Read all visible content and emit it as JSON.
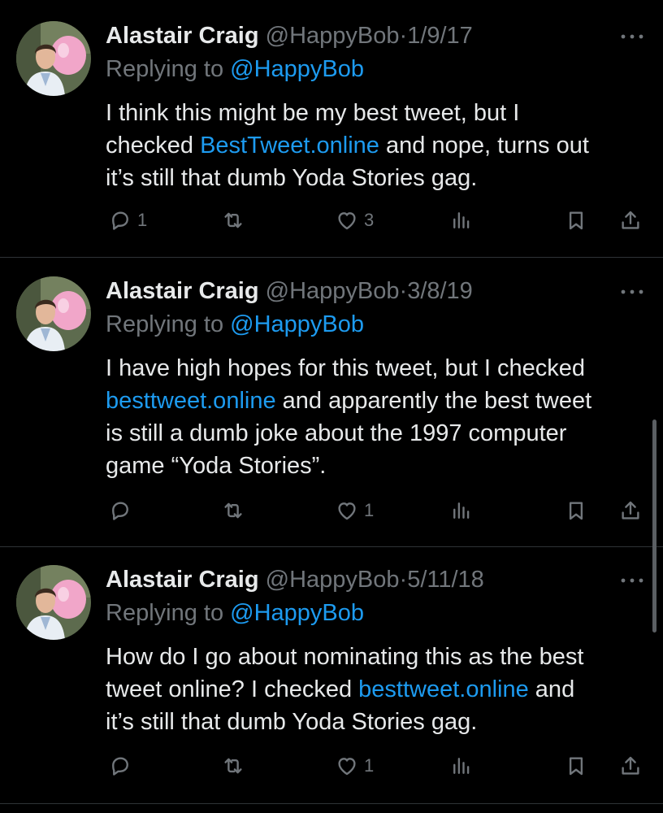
{
  "colors": {
    "background": "#000000",
    "text": "#e7e9ea",
    "muted": "#71767b",
    "link": "#1d9bf0",
    "divider": "#2f3336"
  },
  "tweets": [
    {
      "author_name": "Alastair Craig",
      "handle": "@HappyBob",
      "separator": "·",
      "date": "1/9/17",
      "reply_prefix": "Replying to",
      "reply_to": "@HappyBob",
      "lines": [
        {
          "before": "I think this might be my best tweet, but I",
          "link": "",
          "after": ""
        },
        {
          "before": "checked ",
          "link": "BestTweet.online",
          "after": " and nope, turns out"
        },
        {
          "before": "it’s still that dumb Yoda Stories gag.",
          "link": "",
          "after": ""
        }
      ],
      "counts": {
        "replies": "1",
        "retweets": "",
        "likes": "3"
      }
    },
    {
      "author_name": "Alastair Craig",
      "handle": "@HappyBob",
      "separator": "·",
      "date": "3/8/19",
      "reply_prefix": "Replying to",
      "reply_to": "@HappyBob",
      "lines": [
        {
          "before": "I have high hopes for this tweet, but I checked",
          "link": "",
          "after": ""
        },
        {
          "before": "",
          "link": "besttweet.online",
          "after": " and apparently the best tweet"
        },
        {
          "before": "is still a dumb joke about the 1997 computer",
          "link": "",
          "after": ""
        },
        {
          "before": "game “Yoda Stories”.",
          "link": "",
          "after": ""
        }
      ],
      "counts": {
        "replies": "",
        "retweets": "",
        "likes": "1"
      }
    },
    {
      "author_name": "Alastair Craig",
      "handle": "@HappyBob",
      "separator": "·",
      "date": "5/11/18",
      "reply_prefix": "Replying to",
      "reply_to": "@HappyBob",
      "lines": [
        {
          "before": "How do I go about nominating this as the best",
          "link": "",
          "after": ""
        },
        {
          "before": "tweet online? I checked ",
          "link": "besttweet.online",
          "after": " and"
        },
        {
          "before": "it’s still that dumb Yoda Stories gag.",
          "link": "",
          "after": ""
        }
      ],
      "counts": {
        "replies": "",
        "retweets": "",
        "likes": "1"
      }
    }
  ],
  "icons": {
    "more": "more-horizontal-icon",
    "reply": "reply-icon",
    "retweet": "retweet-icon",
    "like": "heart-icon",
    "views": "views-chart-icon",
    "bookmark": "bookmark-icon",
    "share": "share-icon"
  }
}
